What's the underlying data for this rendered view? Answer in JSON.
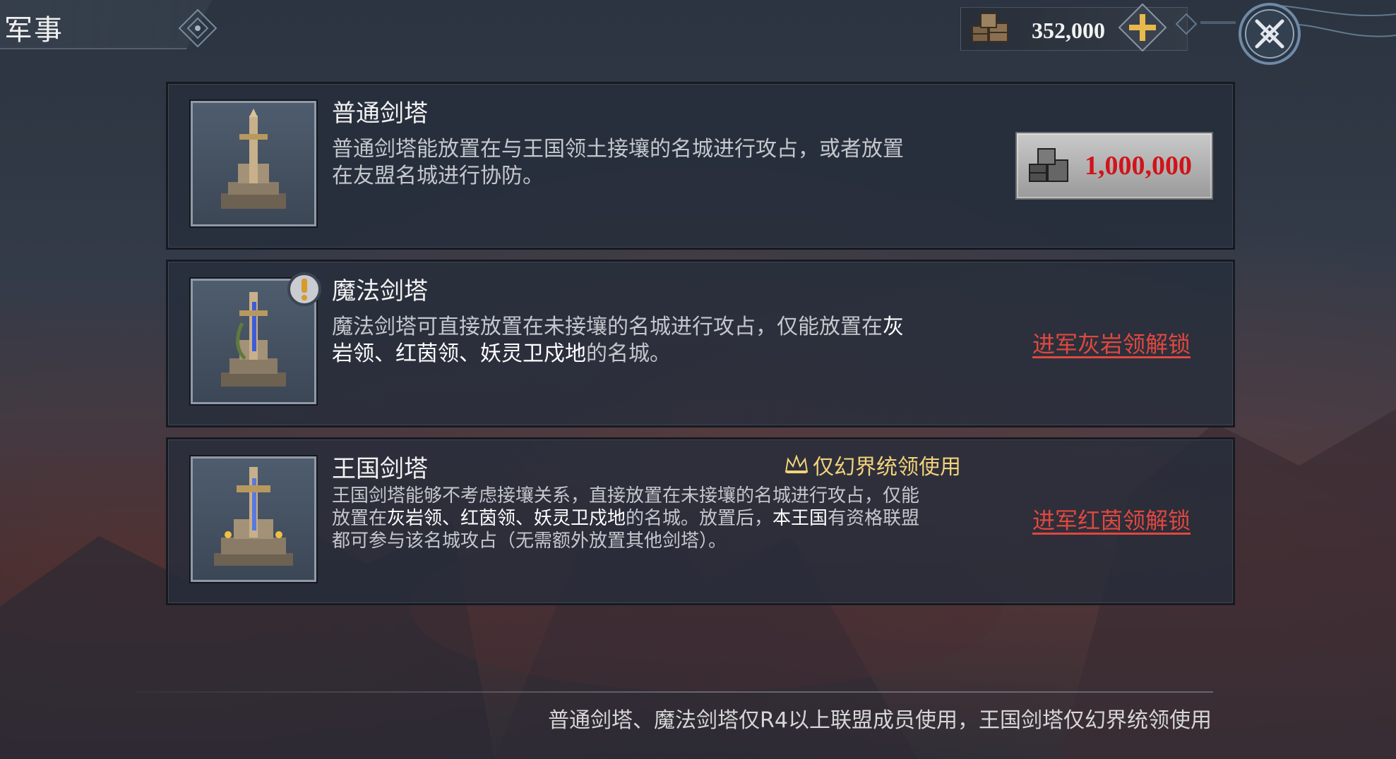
{
  "header": {
    "title": "军事",
    "resource_value": "352,000",
    "resource_icon": "supply-crates-icon",
    "add_icon": "plus-icon",
    "close_icon": "close-icon"
  },
  "cards": [
    {
      "title": "普通剑塔",
      "desc_line1": "普通剑塔能放置在与王国领土接壤的名城进行攻占，或者放置",
      "desc_line2": "在友盟名城进行协防。",
      "cost": "1,000,000",
      "cost_icon": "supply-crates-icon"
    },
    {
      "title": "魔法剑塔",
      "desc_line1_a": "魔法剑塔可直接放置在未接壤的名城进行攻占，仅能放置在",
      "desc_line1_b": "灰",
      "desc_line2_a": "岩领、红茵领、妖灵卫戍地",
      "desc_line2_b": "的名城。",
      "badge_icon": "exclamation-icon",
      "unlock_text": "进军灰岩领解锁"
    },
    {
      "title": "王国剑塔",
      "restriction": "仅幻界统领使用",
      "restriction_icon": "crown-icon",
      "desc_line1": "王国剑塔能够不考虑接壤关系，直接放置在未接壤的名城进行攻占，仅能",
      "desc_line2_a": "放置在",
      "desc_line2_b": "灰岩领、红茵领、妖灵卫戍地",
      "desc_line2_c": "的名城。放置后，",
      "desc_line2_d": "本王国",
      "desc_line2_e": "有资格联盟",
      "desc_line3": "都可参与该名城攻占（无需额外放置其他剑塔）。",
      "unlock_text": "进军红茵领解锁"
    }
  ],
  "footer": {
    "note": "普通剑塔、魔法剑塔仅R4以上联盟成员使用，王国剑塔仅幻界统领使用"
  },
  "colors": {
    "cost_red": "#d0141a",
    "unlock_red": "#e0483f",
    "restriction_gold": "#f2d27a"
  }
}
